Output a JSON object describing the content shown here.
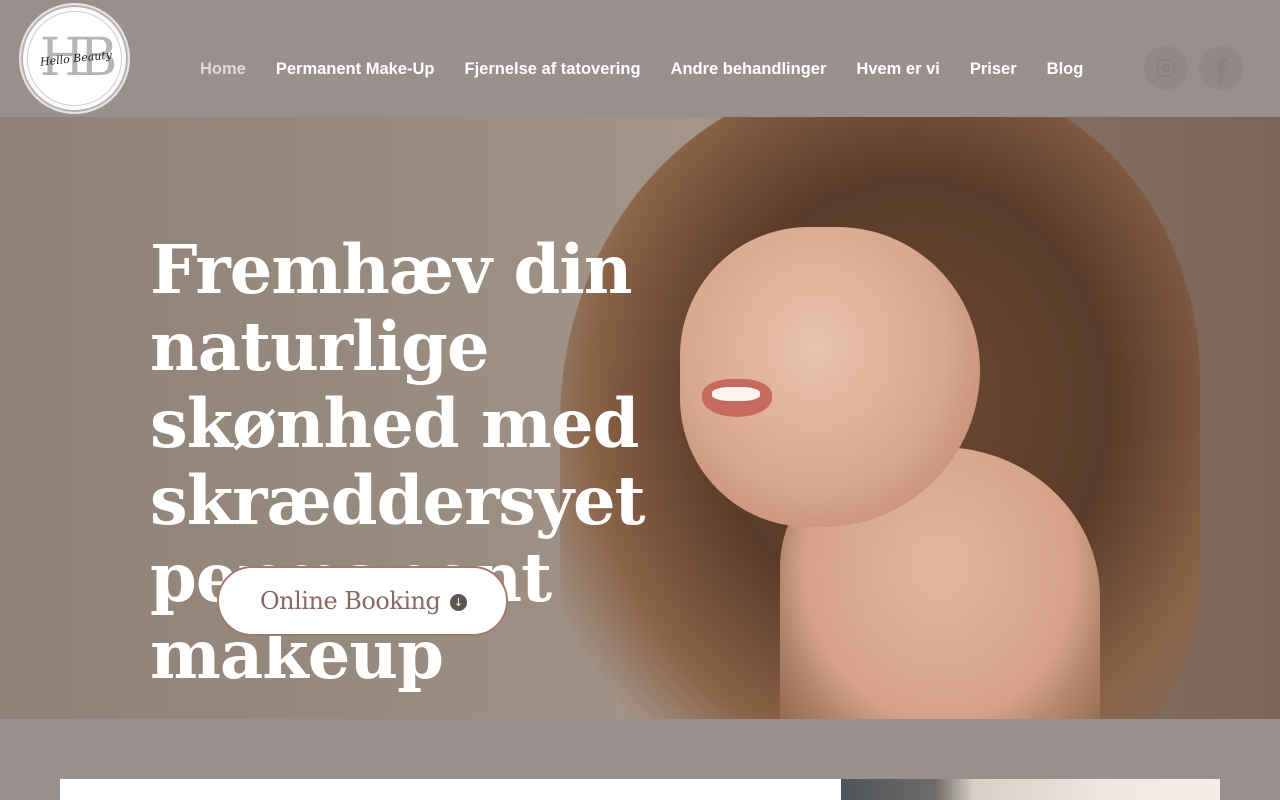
{
  "header": {
    "logo": {
      "letters": "HB",
      "script_text": "Hello Beauty"
    },
    "nav": [
      {
        "label": "Home",
        "active": true
      },
      {
        "label": "Permanent Make-Up",
        "active": false
      },
      {
        "label": "Fjernelse af tatovering",
        "active": false
      },
      {
        "label": "Andre behandlinger",
        "active": false
      },
      {
        "label": "Hvem er vi",
        "active": false
      },
      {
        "label": "Priser",
        "active": false
      },
      {
        "label": "Blog",
        "active": false
      }
    ],
    "social": [
      {
        "icon": "instagram-icon"
      },
      {
        "icon": "facebook-icon",
        "glyph": "f"
      }
    ]
  },
  "hero": {
    "title": "Fremhæv din naturlige skønhed med skræddersyet permanent makeup",
    "cta": {
      "label": "Online Booking",
      "icon": "arrow-down-circle-icon",
      "glyph": "↓"
    }
  },
  "colors": {
    "header_bg": "#9a8f8f",
    "nav_text": "#ffffff",
    "nav_active": "#e0dbdb",
    "cta_text": "#8a6a60",
    "cta_border": "#a27b6a"
  }
}
